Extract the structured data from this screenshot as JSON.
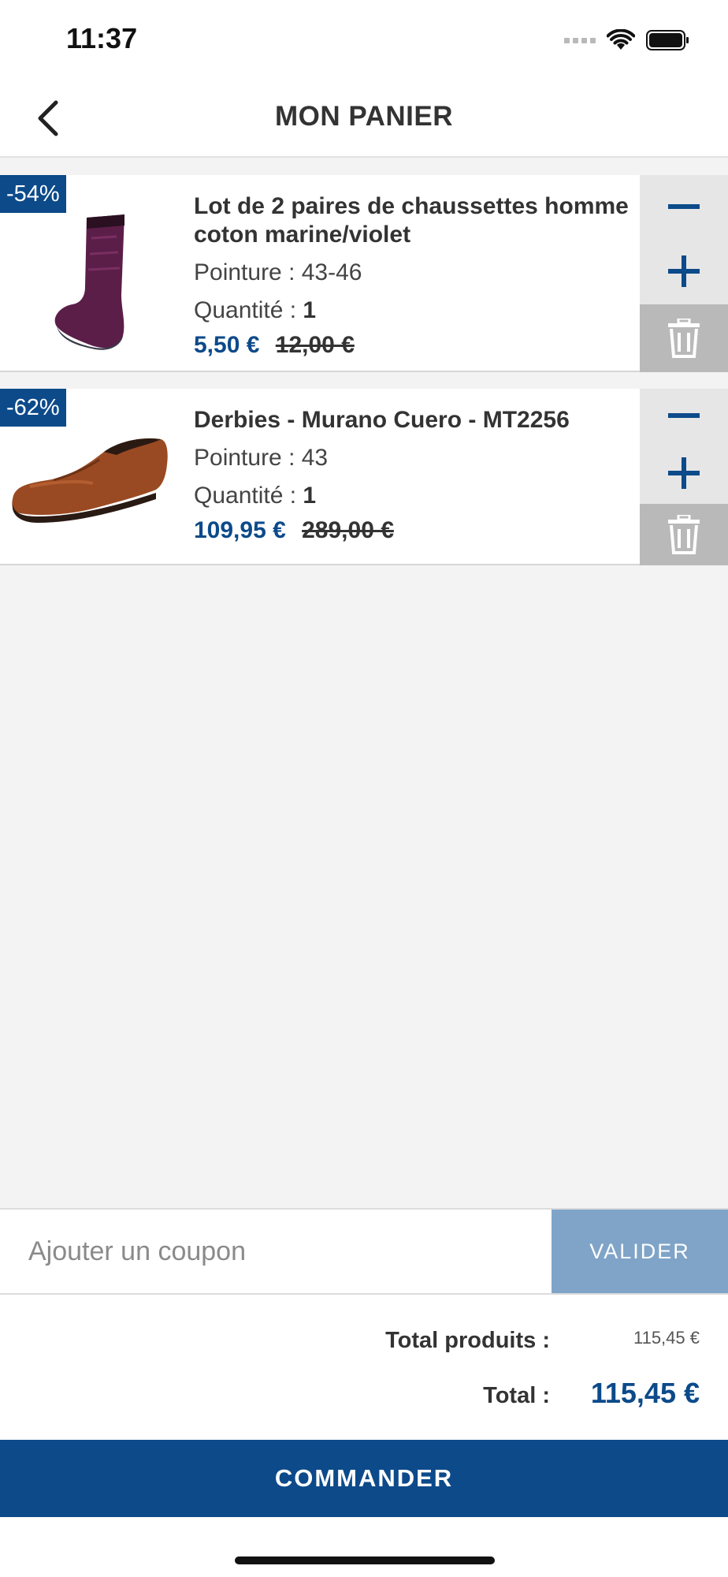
{
  "status_bar": {
    "time": "11:37"
  },
  "header": {
    "title": "MON PANIER"
  },
  "cart": {
    "items": [
      {
        "discount": "-54%",
        "name": "Lot de 2 paires de chaussettes homme coton marine/violet",
        "size_text": "Pointure : 43-46",
        "qty_label": "Quantité : ",
        "qty_value": "1",
        "price_new": "5,50 €",
        "price_old": "12,00 €",
        "image_icon": "socks-product-image"
      },
      {
        "discount": "-62%",
        "name": "Derbies - Murano Cuero - MT2256",
        "size_text": "Pointure : 43",
        "qty_label": "Quantité : ",
        "qty_value": "1",
        "price_new": "109,95 €",
        "price_old": "289,00 €",
        "image_icon": "shoe-product-image"
      }
    ]
  },
  "coupon": {
    "placeholder": "Ajouter un coupon",
    "button_label": "VALIDER"
  },
  "totals": {
    "products_label": "Total produits :",
    "products_value": "115,45 €",
    "total_label": "Total :",
    "total_value": "115,45 €"
  },
  "order_button": "COMMANDER",
  "colors": {
    "primary": "#0c4a8a",
    "validate_button": "#7fa4c8",
    "delete_bg": "#b9b9b9"
  }
}
